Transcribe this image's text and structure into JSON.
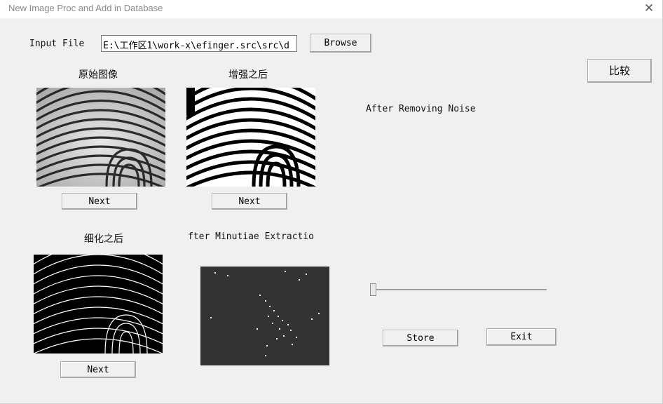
{
  "window": {
    "title": "New Image Proc and Add in Database",
    "close_glyph": "✕"
  },
  "input_file": {
    "label": "Input File",
    "value": "E:\\工作区1\\work-x\\efinger.src\\src\\d",
    "browse_label": "Browse"
  },
  "compare_label": "比较",
  "panels": {
    "original": {
      "label": "原始图像",
      "next_label": "Next"
    },
    "enhanced": {
      "label": "增强之后",
      "next_label": "Next"
    },
    "noise": {
      "label": "After Removing Noise"
    },
    "thinned": {
      "label": "细化之后",
      "next_label": "Next"
    },
    "minutiae": {
      "label": "fter Minutiae Extractio"
    }
  },
  "actions": {
    "store_label": "Store",
    "exit_label": "Exit"
  },
  "colors": {
    "dark_panel": "#333333",
    "image_bg_gray": "#c8c8c8"
  },
  "slider": {
    "value": 0
  }
}
